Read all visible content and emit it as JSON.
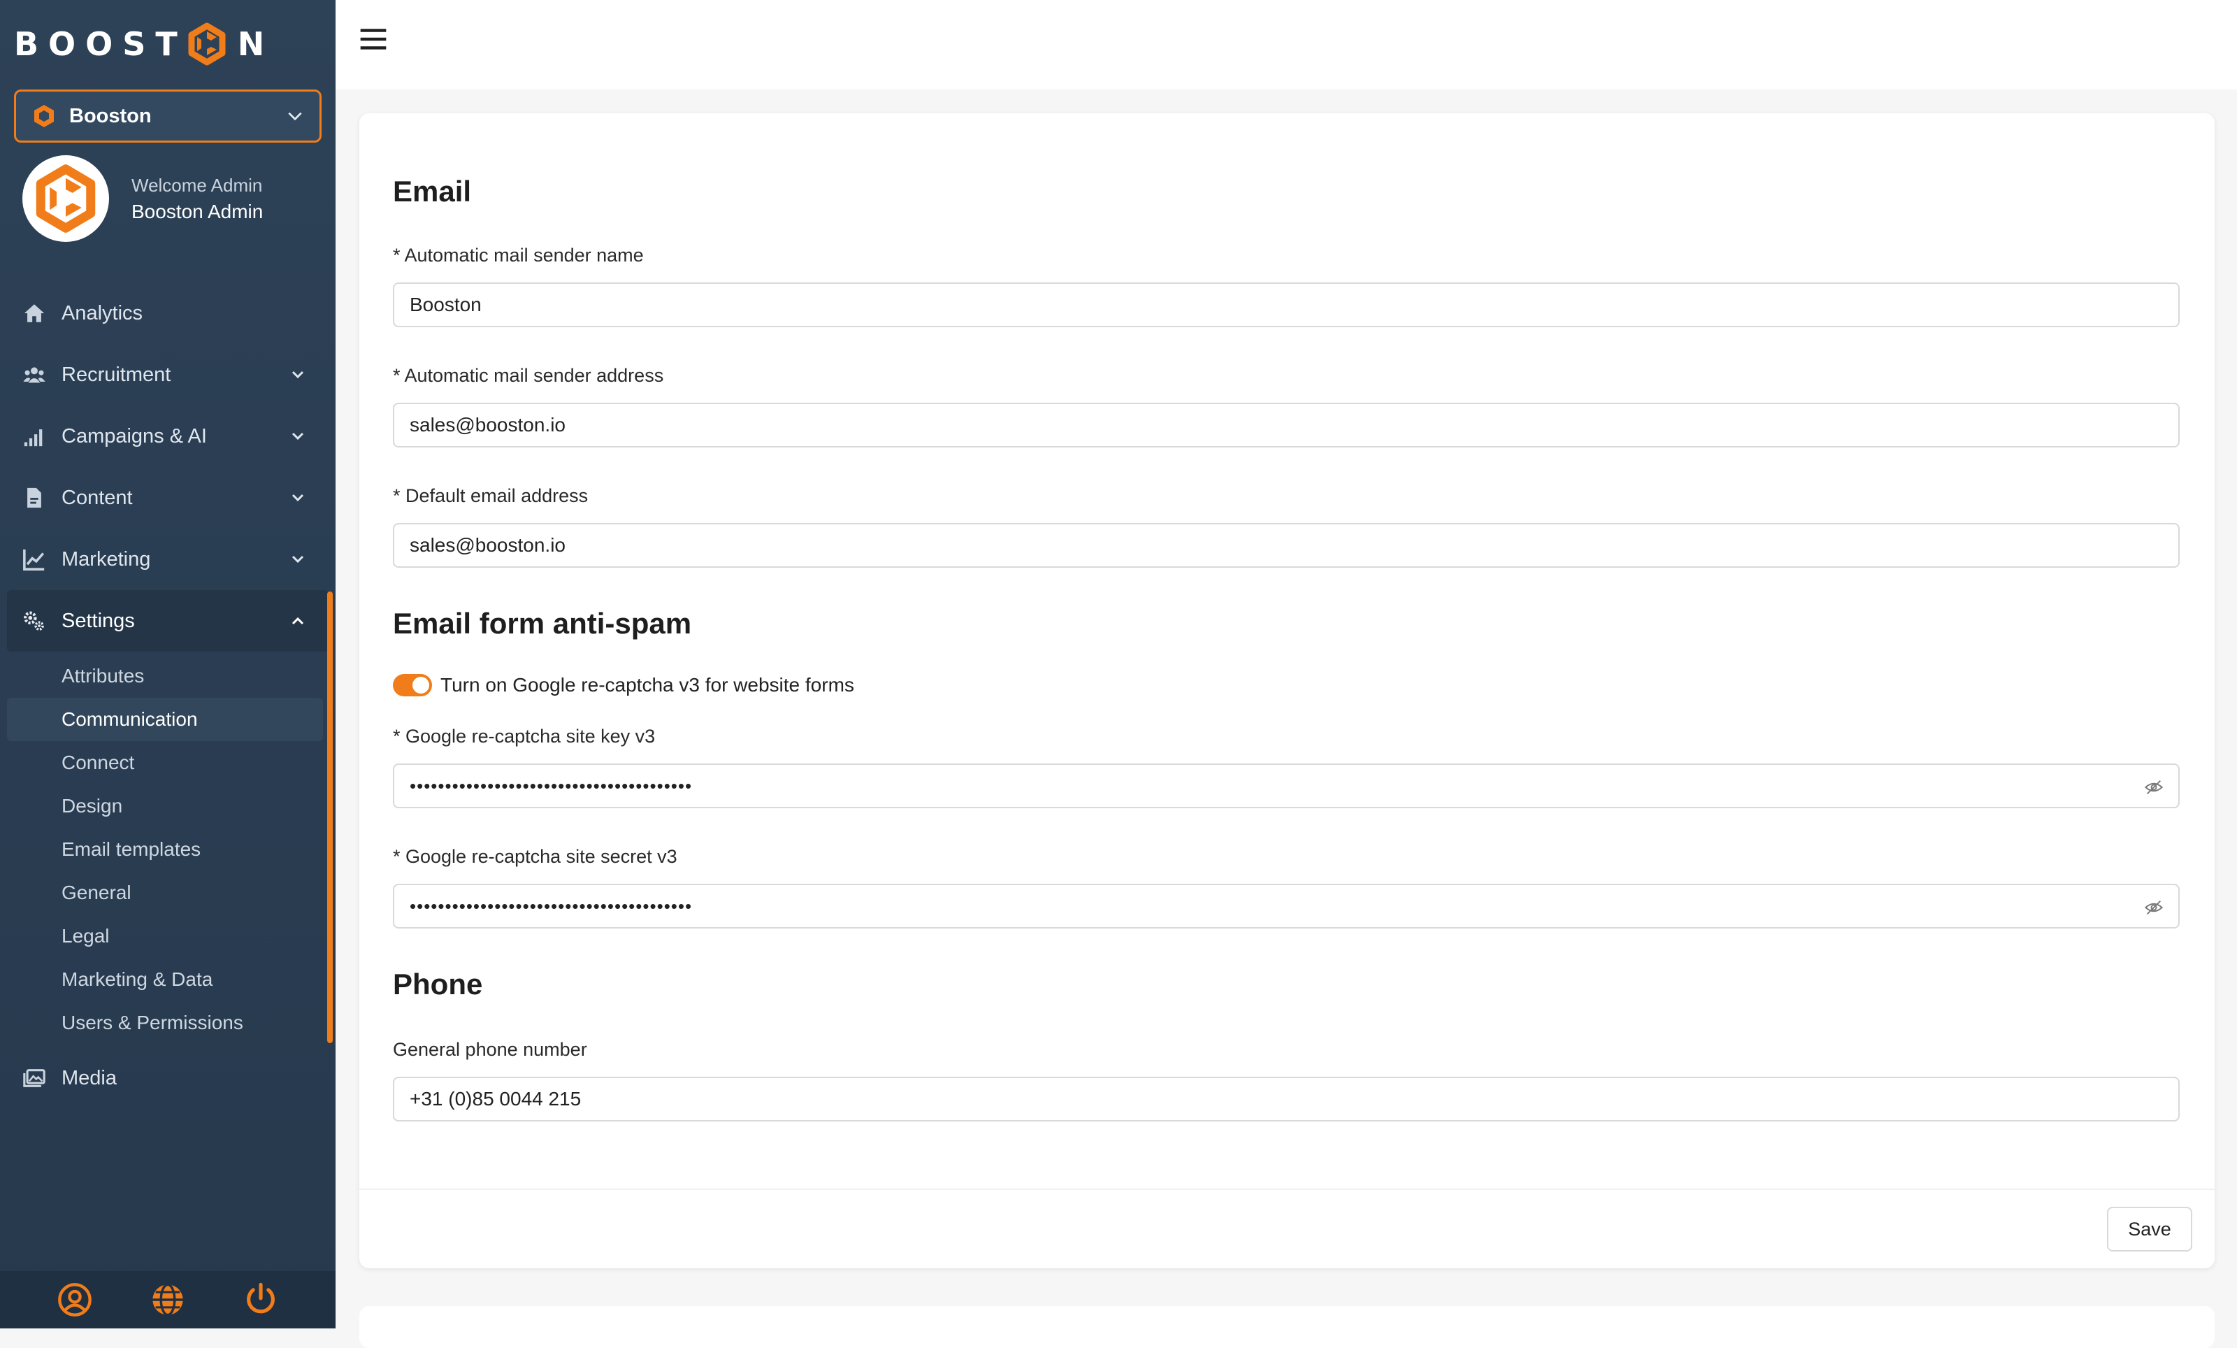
{
  "brand": {
    "name_left": "BOOST",
    "name_right": "N"
  },
  "org_select": {
    "value": "Booston"
  },
  "user": {
    "welcome": "Welcome Admin",
    "name": "Booston Admin"
  },
  "nav": {
    "analytics": "Analytics",
    "recruitment": "Recruitment",
    "campaigns": "Campaigns & AI",
    "content": "Content",
    "marketing": "Marketing",
    "settings": "Settings",
    "media": "Media"
  },
  "settings_sub": [
    "Attributes",
    "Communication",
    "Connect",
    "Design",
    "Email templates",
    "General",
    "Legal",
    "Marketing & Data",
    "Users & Permissions"
  ],
  "form": {
    "email_title": "Email",
    "sender_name_label": "* Automatic mail sender name",
    "sender_name_value": "Booston",
    "sender_address_label": "* Automatic mail sender address",
    "sender_address_value": "sales@booston.io",
    "default_email_label": "* Default email address",
    "default_email_value": "sales@booston.io",
    "antispam_title": "Email form anti-spam",
    "recaptcha_toggle_label": "Turn on Google re-captcha v3 for website forms",
    "recaptcha_toggle_on": true,
    "site_key_label": "* Google re-captcha site key v3",
    "site_key_value": "••••••••••••••••••••••••••••••••••••••••",
    "site_secret_label": "* Google re-captcha site secret v3",
    "site_secret_value": "••••••••••••••••••••••••••••••••••••••••",
    "phone_title": "Phone",
    "phone_label": "General phone number",
    "phone_value": "+31 (0)85 0044 215",
    "save_label": "Save"
  },
  "colors": {
    "accent": "#f07d1a",
    "sidebar_bg": "#2d4157",
    "sidebar_footer": "#1f3043"
  },
  "icons": {
    "analytics": "home-icon",
    "recruitment": "users-icon",
    "campaigns": "signal-bars-icon",
    "content": "file-icon",
    "marketing": "line-chart-icon",
    "settings": "gears-icon",
    "media": "images-icon",
    "footer": [
      "user-circle-icon",
      "globe-icon",
      "power-icon"
    ]
  }
}
